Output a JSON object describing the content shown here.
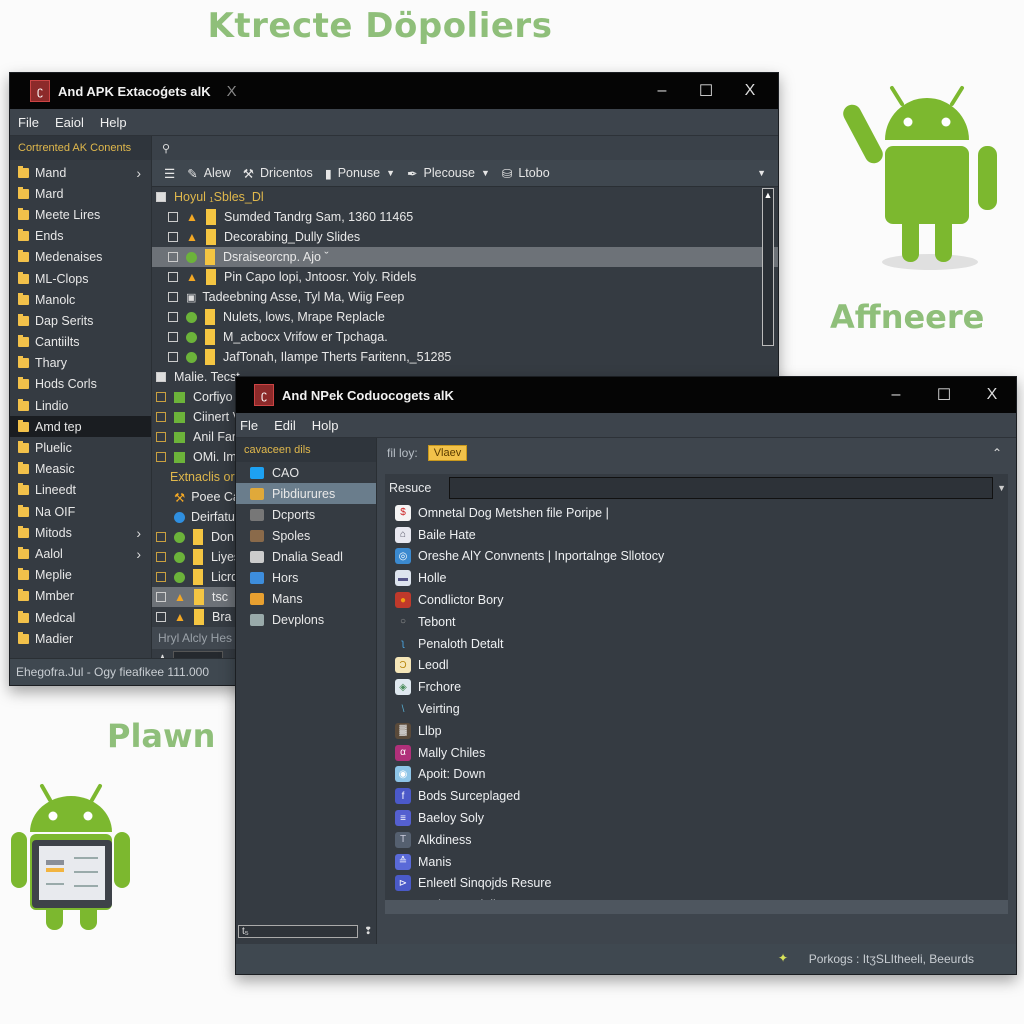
{
  "headline": "Ktrecte Döpoliers",
  "side_labels": {
    "right": "Affneere",
    "left": "Plawn"
  },
  "colors": {
    "accent_green": "#8fbf7a",
    "android_green": "#7cb82f",
    "folder_yellow": "#f2c14a",
    "warning_orange": "#f3a825",
    "badge_yellow": "#f2c24a"
  },
  "window1": {
    "title": "And APK Extacoǵets alK",
    "tab_close": "X",
    "controls": {
      "minimize": "–",
      "maximize": "☐",
      "close": "X"
    },
    "menu": [
      "File",
      "Eaiol",
      "Help"
    ],
    "sidebar": {
      "header": "Cortrented AK Conents",
      "items": [
        {
          "label": "Mand",
          "chevron": true
        },
        {
          "label": "Mard",
          "chevron": false
        },
        {
          "label": "Meete Lires",
          "chevron": false
        },
        {
          "label": "Ends",
          "chevron": false
        },
        {
          "label": "Medenaises",
          "chevron": false
        },
        {
          "label": "ML-Clops",
          "chevron": false
        },
        {
          "label": "Manolc",
          "chevron": false
        },
        {
          "label": "Dap Serits",
          "chevron": false
        },
        {
          "label": "Cantiilts",
          "chevron": false
        },
        {
          "label": "Thary",
          "chevron": false
        },
        {
          "label": "Hods Corls",
          "chevron": false
        },
        {
          "label": "Lindio",
          "chevron": false
        },
        {
          "label": "Amd tep",
          "chevron": false,
          "selected": true
        },
        {
          "label": "Pluelic",
          "chevron": false
        },
        {
          "label": "Measic",
          "chevron": false
        },
        {
          "label": "Lineedt",
          "chevron": false
        },
        {
          "label": "Na OIF",
          "chevron": false
        },
        {
          "label": "Mitods",
          "chevron": true
        },
        {
          "label": "Aalol",
          "chevron": true
        },
        {
          "label": "Meplie",
          "chevron": false
        },
        {
          "label": "Mmber",
          "chevron": false
        },
        {
          "label": "Medcal",
          "chevron": false
        },
        {
          "label": "Madier",
          "chevron": false
        }
      ]
    },
    "toolbar": {
      "top_icon": "filter-icon",
      "buttons": [
        {
          "icon": "list-icon",
          "label": ""
        },
        {
          "icon": "pencil-icon",
          "label": "Alew"
        },
        {
          "icon": "tools-icon",
          "label": "Dricentos"
        },
        {
          "icon": "trash-icon",
          "label": "Ponuse",
          "dropdown": true
        },
        {
          "icon": "pen-icon",
          "label": "Plecouse",
          "dropdown": true
        },
        {
          "icon": "package-icon",
          "label": "Ltobo"
        }
      ]
    },
    "tree_root": "Hoyul ₁Sbles_Dl",
    "files": [
      {
        "icon": "warning",
        "label": "Sumded Tandrg Sam, 1360 11465"
      },
      {
        "icon": "warning",
        "label": "Decorabing_Dully Slides"
      },
      {
        "icon": "green",
        "label": "Dsraiseorcnp. Ajo ˇ",
        "highlighted": true
      },
      {
        "icon": "warning",
        "label": "Pin Capo lopi, Jntoosr. Yoly. Ridels"
      },
      {
        "icon": "doc",
        "label": "Tadeebning Asse, Tyl Ma, Wiig Feep"
      },
      {
        "icon": "green",
        "label": "Nulets, lows, Mrape Replacle"
      },
      {
        "icon": "green",
        "label": "M_acbocx Vrifow er Tpchaga."
      },
      {
        "icon": "green",
        "label": "JafTonah, Ilampe Therts Faritenn,_51285"
      }
    ],
    "tree_root2": "Malie. Tecst",
    "lower_items": [
      {
        "icon": "green-square",
        "label": "Corfiyo fa"
      },
      {
        "icon": "green-square",
        "label": "Ciinert V"
      },
      {
        "icon": "green-square",
        "label": "Anil Fam"
      },
      {
        "icon": "green-square",
        "label": "OMi. Imo"
      },
      {
        "icon": "none",
        "label": "Extnaclis orn",
        "header": true
      },
      {
        "icon": "wrench",
        "label": "Poee Can"
      },
      {
        "icon": "blue-gear",
        "label": "Deirfatu"
      },
      {
        "icon": "green",
        "label": "Don"
      },
      {
        "icon": "green",
        "label": "Liyes"
      },
      {
        "icon": "green",
        "label": "Licrd"
      },
      {
        "icon": "warning",
        "label": "tsc",
        "highlighted": true
      },
      {
        "icon": "warning",
        "label": "Bra"
      }
    ],
    "filter_label": "Hryl Alcly Hes",
    "status": "Ehegofra.Jul - Ogy fieafikee 111.000"
  },
  "window2": {
    "title": "And NPek Coduocogets alK",
    "controls": {
      "minimize": "–",
      "maximize": "☐",
      "close": "X"
    },
    "menu": [
      "Fle",
      "Edil",
      "Holp"
    ],
    "sidebar": {
      "header": "cavaceen dils",
      "items": [
        {
          "label": "CAO",
          "icon": "twitter-icon",
          "color": "#1da1f2"
        },
        {
          "label": "Pibdiurures",
          "icon": "image-icon",
          "color": "#e0a93a",
          "selected": true
        },
        {
          "label": "Dcports",
          "icon": "folder-icon",
          "color": "#777"
        },
        {
          "label": "Spoles",
          "icon": "book-icon",
          "color": "#8a6a4a"
        },
        {
          "label": "Dnalia Seadl",
          "icon": "anchor-icon",
          "color": "#ccc"
        },
        {
          "label": "Hors",
          "icon": "bar-icon",
          "color": "#3d8ddc"
        },
        {
          "label": "Mans",
          "icon": "stack-icon",
          "color": "#e8a030"
        },
        {
          "label": "Devplons",
          "icon": "funnel-icon",
          "color": "#9aa"
        }
      ],
      "search_value": "t₅"
    },
    "filter": {
      "label": "fil loy:",
      "badge": "Vlaev"
    },
    "resource_label": "Resuce",
    "resource_value": "",
    "apps": [
      {
        "label": "Omnetal Dog Metshen file Poripe |",
        "icon": "$",
        "color": "#f4f4f4",
        "fg": "#c22"
      },
      {
        "label": "Baile Hate",
        "icon": "⌂",
        "color": "#e8e8f0",
        "fg": "#556"
      },
      {
        "label": "Oreshe AlY Convnents | Inportalnge Sllotocy",
        "icon": "◎",
        "color": "#3b8ad0",
        "fg": "#fff"
      },
      {
        "label": "Holle",
        "icon": "▬",
        "color": "#dde4ee",
        "fg": "#558"
      },
      {
        "label": "Condlictor Bory",
        "icon": "●",
        "color": "#c0392b",
        "fg": "#f39c12"
      },
      {
        "label": "Tebont",
        "icon": "○",
        "color": "transparent",
        "fg": "#999"
      },
      {
        "label": "Penaloth Detalt",
        "icon": "ʅ",
        "color": "transparent",
        "fg": "#4aa3df"
      },
      {
        "label": "Leodl",
        "icon": "Ɔ",
        "color": "#f5e6b8",
        "fg": "#b8860b"
      },
      {
        "label": "Frchore",
        "icon": "◈",
        "color": "#dfe8ef",
        "fg": "#4a8c5a"
      },
      {
        "label": "Veirting",
        "icon": "\\",
        "color": "transparent",
        "fg": "#5ac"
      },
      {
        "label": "Llbp",
        "icon": "▓",
        "color": "#5a4a3a",
        "fg": "#ddd"
      },
      {
        "label": "Mally Chiles",
        "icon": "α",
        "color": "#b0307a",
        "fg": "#fff"
      },
      {
        "label": "Apoit: Down",
        "icon": "◉",
        "color": "#8ec5e8",
        "fg": "#fff"
      },
      {
        "label": "Bods Surceplaged",
        "icon": "f",
        "color": "#4b59c9",
        "fg": "#fff"
      },
      {
        "label": "Baeloy Soly",
        "icon": "≡",
        "color": "#5560d0",
        "fg": "#fff"
      },
      {
        "label": "Alkdiness",
        "icon": "T",
        "color": "#556070",
        "fg": "#ccd"
      },
      {
        "label": "Manis",
        "icon": "≙",
        "color": "#5a6ad8",
        "fg": "#fff"
      },
      {
        "label": "Enleetl Sinqojds Resure",
        "icon": "⊳",
        "color": "#4a5ac8",
        "fg": "#fff"
      },
      {
        "label": "Toalez Coplojicest",
        "icon": "ʋ",
        "color": "transparent",
        "fg": "#4aa3df"
      }
    ],
    "status": "Porkogs : ItʒSLItheeli, Beeurds",
    "status_icon": "pin-icon"
  }
}
